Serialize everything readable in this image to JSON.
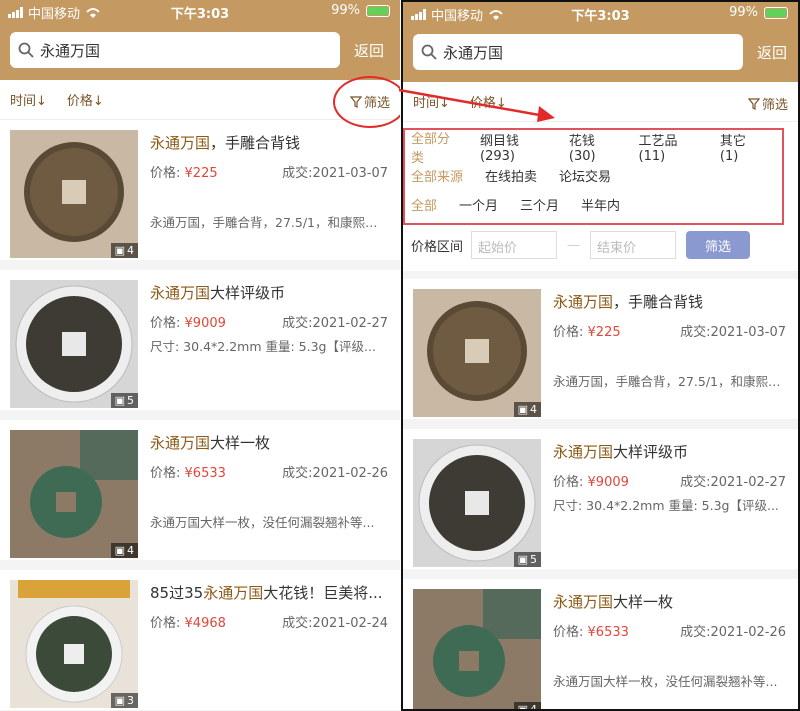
{
  "status": {
    "carrier": "中国移动",
    "time": "下午3:03",
    "battery": "99%"
  },
  "search": {
    "value": "永通万国",
    "back_label": "返回"
  },
  "sort": {
    "time": "时间↓",
    "price": "价格↓",
    "filter": "筛选"
  },
  "filters": {
    "category": [
      "全部分类",
      "纲目钱(293)",
      "花钱(30)",
      "工艺品(11)",
      "其它(1)"
    ],
    "source": [
      "全部来源",
      "在线拍卖",
      "论坛交易"
    ],
    "period": [
      "全部",
      "一个月",
      "三个月",
      "半年内"
    ],
    "price_label": "价格区间",
    "price_min_placeholder": "起始价",
    "price_max_placeholder": "结束价",
    "apply_label": "筛选"
  },
  "items": [
    {
      "kw": "永通万国",
      "rest": "，手雕合背钱",
      "price_label": "价格:",
      "price": "¥225",
      "deal": "成交:2021-03-07",
      "size": "",
      "desc": "永通万国，手雕合背，27.5/1，和康熙那...",
      "img_count": "4"
    },
    {
      "kw": "永通万国",
      "rest": "大样评级币",
      "price_label": "价格:",
      "price": "¥9009",
      "deal": "成交:2021-02-27",
      "size": "尺寸:  30.4*2.2mm 重量:  5.3g【评级...",
      "desc": "",
      "img_count": "5"
    },
    {
      "kw": "永通万国",
      "rest": "大样一枚",
      "price_label": "价格:",
      "price": "¥6533",
      "deal": "成交:2021-02-26",
      "size": "",
      "desc": "永通万国大样一枚，没任何漏裂翘补等...",
      "img_count": "4"
    },
    {
      "prefix": "85过35",
      "kw": "永通万国",
      "rest": "大花钱！巨美将...",
      "price_label": "价格:",
      "price": "¥4968",
      "deal": "成交:2021-02-24",
      "size": "",
      "desc": "",
      "img_count": "3"
    }
  ],
  "colors": {
    "header": "#c49a62",
    "accent": "#8b5a17",
    "price": "#e0473a",
    "annotation": "#e12b2b"
  },
  "icons": [
    "search-icon",
    "filter-icon",
    "image-count-icon",
    "wifi-icon",
    "signal-icon",
    "battery-icon"
  ]
}
